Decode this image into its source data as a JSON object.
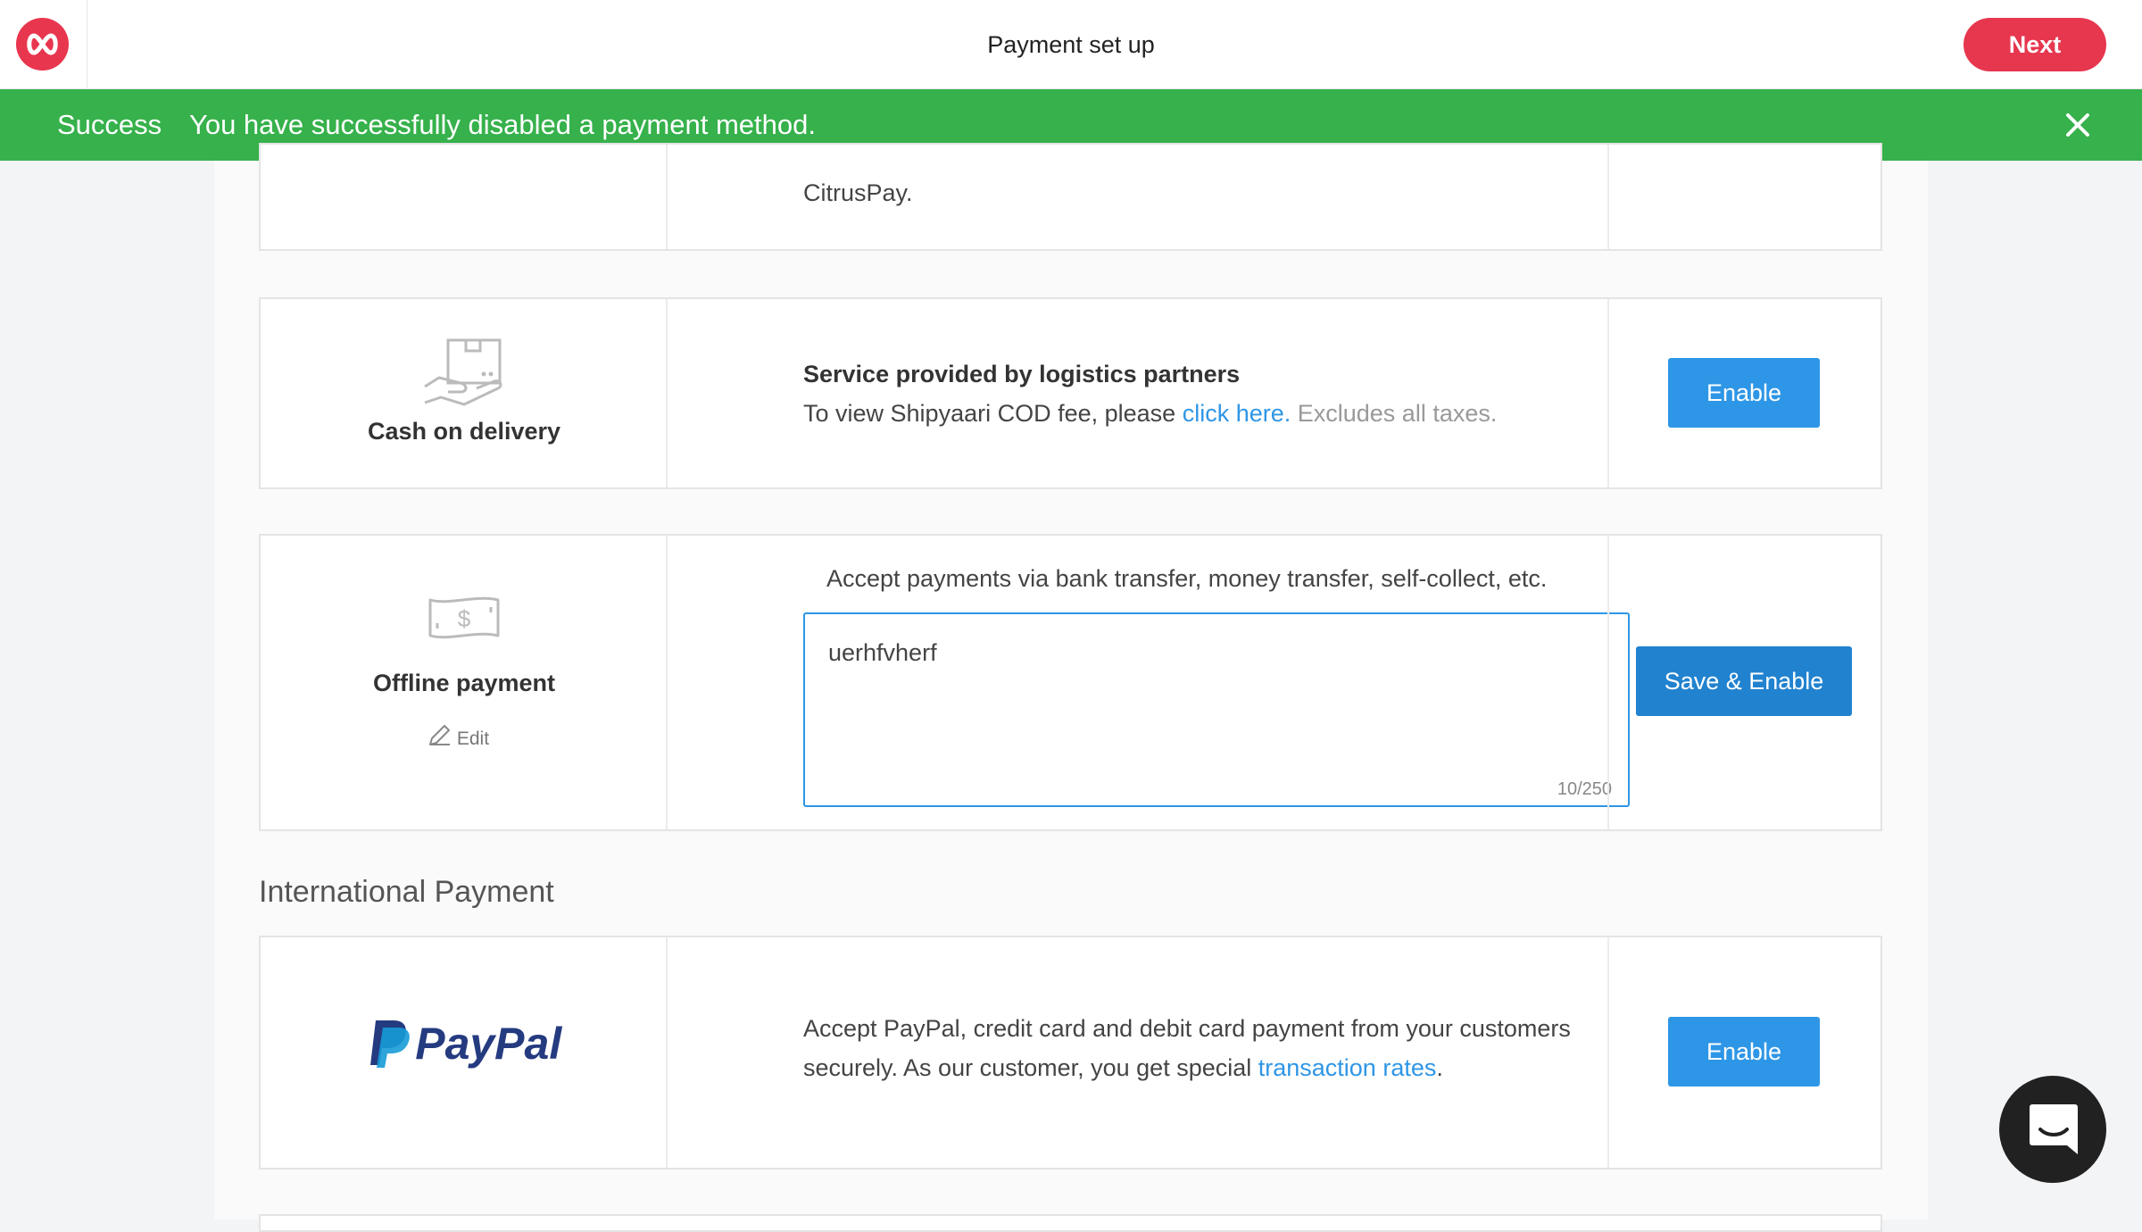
{
  "header": {
    "title": "Payment set up",
    "next_label": "Next"
  },
  "banner": {
    "title": "Success",
    "message": "You have successfully disabled a payment method."
  },
  "citrus": {
    "text_tail": "CitrusPay."
  },
  "cod": {
    "label": "Cash on delivery",
    "heading": "Service provided by logistics partners",
    "text_before": "To view Shipyaari COD fee, please ",
    "link": "click here.",
    "text_after": " Excludes all taxes.",
    "button": "Enable"
  },
  "offline": {
    "label": "Offline payment",
    "edit_label": "Edit",
    "description": "Accept payments via bank transfer, money transfer, self-collect, etc.",
    "input_value": "uerhfvherf",
    "char_count": "10/250",
    "button": "Save & Enable"
  },
  "international": {
    "section_title": "International Payment",
    "paypal_logo": "PayPal",
    "line1": "Accept PayPal, credit card and debit card payment from your customers",
    "line2_before": "securely. As our customer, you get special ",
    "line2_link": "transaction rates",
    "line2_after": ".",
    "button": "Enable"
  },
  "colors": {
    "brand_red": "#e6374f",
    "success_green": "#36b14b",
    "primary_blue": "#2e96e6",
    "paypal_dark": "#253b80",
    "paypal_light": "#179bd7"
  }
}
